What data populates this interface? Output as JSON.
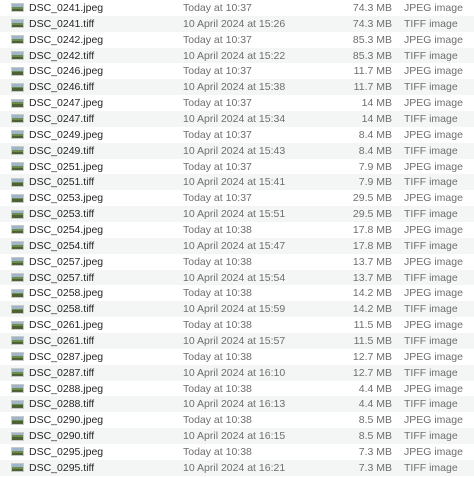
{
  "files": [
    {
      "name": "DSC_0241.jpeg",
      "date": "Today at 10:37",
      "size": "74.3 MB",
      "kind": "JPEG image",
      "icon": "image-thumbnail-icon"
    },
    {
      "name": "DSC_0241.tiff",
      "date": "10 April 2024 at 15:26",
      "size": "74.3 MB",
      "kind": "TIFF image",
      "icon": "image-thumbnail-icon"
    },
    {
      "name": "DSC_0242.jpeg",
      "date": "Today at 10:37",
      "size": "85.3 MB",
      "kind": "JPEG image",
      "icon": "image-thumbnail-icon"
    },
    {
      "name": "DSC_0242.tiff",
      "date": "10 April 2024 at 15:22",
      "size": "85.3 MB",
      "kind": "TIFF image",
      "icon": "image-thumbnail-icon"
    },
    {
      "name": "DSC_0246.jpeg",
      "date": "Today at 10:37",
      "size": "11.7 MB",
      "kind": "JPEG image",
      "icon": "image-thumbnail-icon"
    },
    {
      "name": "DSC_0246.tiff",
      "date": "10 April 2024 at 15:38",
      "size": "11.7 MB",
      "kind": "TIFF image",
      "icon": "image-thumbnail-icon"
    },
    {
      "name": "DSC_0247.jpeg",
      "date": "Today at 10:37",
      "size": "14 MB",
      "kind": "JPEG image",
      "icon": "image-thumbnail-icon"
    },
    {
      "name": "DSC_0247.tiff",
      "date": "10 April 2024 at 15:34",
      "size": "14 MB",
      "kind": "TIFF image",
      "icon": "image-thumbnail-icon"
    },
    {
      "name": "DSC_0249.jpeg",
      "date": "Today at 10:37",
      "size": "8.4 MB",
      "kind": "JPEG image",
      "icon": "image-thumbnail-icon"
    },
    {
      "name": "DSC_0249.tiff",
      "date": "10 April 2024 at 15:43",
      "size": "8.4 MB",
      "kind": "TIFF image",
      "icon": "image-thumbnail-icon"
    },
    {
      "name": "DSC_0251.jpeg",
      "date": "Today at 10:37",
      "size": "7.9 MB",
      "kind": "JPEG image",
      "icon": "image-thumbnail-icon"
    },
    {
      "name": "DSC_0251.tiff",
      "date": "10 April 2024 at 15:41",
      "size": "7.9 MB",
      "kind": "TIFF image",
      "icon": "image-thumbnail-icon"
    },
    {
      "name": "DSC_0253.jpeg",
      "date": "Today at 10:37",
      "size": "29.5 MB",
      "kind": "JPEG image",
      "icon": "image-thumbnail-icon"
    },
    {
      "name": "DSC_0253.tiff",
      "date": "10 April 2024 at 15:51",
      "size": "29.5 MB",
      "kind": "TIFF image",
      "icon": "image-thumbnail-icon"
    },
    {
      "name": "DSC_0254.jpeg",
      "date": "Today at 10:38",
      "size": "17.8 MB",
      "kind": "JPEG image",
      "icon": "image-thumbnail-icon"
    },
    {
      "name": "DSC_0254.tiff",
      "date": "10 April 2024 at 15:47",
      "size": "17.8 MB",
      "kind": "TIFF image",
      "icon": "image-thumbnail-icon"
    },
    {
      "name": "DSC_0257.jpeg",
      "date": "Today at 10:38",
      "size": "13.7 MB",
      "kind": "JPEG image",
      "icon": "image-thumbnail-icon"
    },
    {
      "name": "DSC_0257.tiff",
      "date": "10 April 2024 at 15:54",
      "size": "13.7 MB",
      "kind": "TIFF image",
      "icon": "image-thumbnail-icon"
    },
    {
      "name": "DSC_0258.jpeg",
      "date": "Today at 10:38",
      "size": "14.2 MB",
      "kind": "JPEG image",
      "icon": "image-thumbnail-icon"
    },
    {
      "name": "DSC_0258.tiff",
      "date": "10 April 2024 at 15:59",
      "size": "14.2 MB",
      "kind": "TIFF image",
      "icon": "image-thumbnail-icon"
    },
    {
      "name": "DSC_0261.jpeg",
      "date": "Today at 10:38",
      "size": "11.5 MB",
      "kind": "JPEG image",
      "icon": "image-thumbnail-icon"
    },
    {
      "name": "DSC_0261.tiff",
      "date": "10 April 2024 at 15:57",
      "size": "11.5 MB",
      "kind": "TIFF image",
      "icon": "image-thumbnail-icon"
    },
    {
      "name": "DSC_0287.jpeg",
      "date": "Today at 10:38",
      "size": "12.7 MB",
      "kind": "JPEG image",
      "icon": "image-thumbnail-icon"
    },
    {
      "name": "DSC_0287.tiff",
      "date": "10 April 2024 at 16:10",
      "size": "12.7 MB",
      "kind": "TIFF image",
      "icon": "image-thumbnail-icon"
    },
    {
      "name": "DSC_0288.jpeg",
      "date": "Today at 10:38",
      "size": "4.4 MB",
      "kind": "JPEG image",
      "icon": "image-thumbnail-icon"
    },
    {
      "name": "DSC_0288.tiff",
      "date": "10 April 2024 at 16:13",
      "size": "4.4 MB",
      "kind": "TIFF image",
      "icon": "image-thumbnail-icon"
    },
    {
      "name": "DSC_0290.jpeg",
      "date": "Today at 10:38",
      "size": "8.5 MB",
      "kind": "JPEG image",
      "icon": "image-thumbnail-icon"
    },
    {
      "name": "DSC_0290.tiff",
      "date": "10 April 2024 at 16:15",
      "size": "8.5 MB",
      "kind": "TIFF image",
      "icon": "image-thumbnail-icon"
    },
    {
      "name": "DSC_0295.jpeg",
      "date": "Today at 10:38",
      "size": "7.3 MB",
      "kind": "JPEG image",
      "icon": "image-thumbnail-icon"
    },
    {
      "name": "DSC_0295.tiff",
      "date": "10 April 2024 at 16:21",
      "size": "7.3 MB",
      "kind": "TIFF image",
      "icon": "image-thumbnail-icon"
    }
  ]
}
